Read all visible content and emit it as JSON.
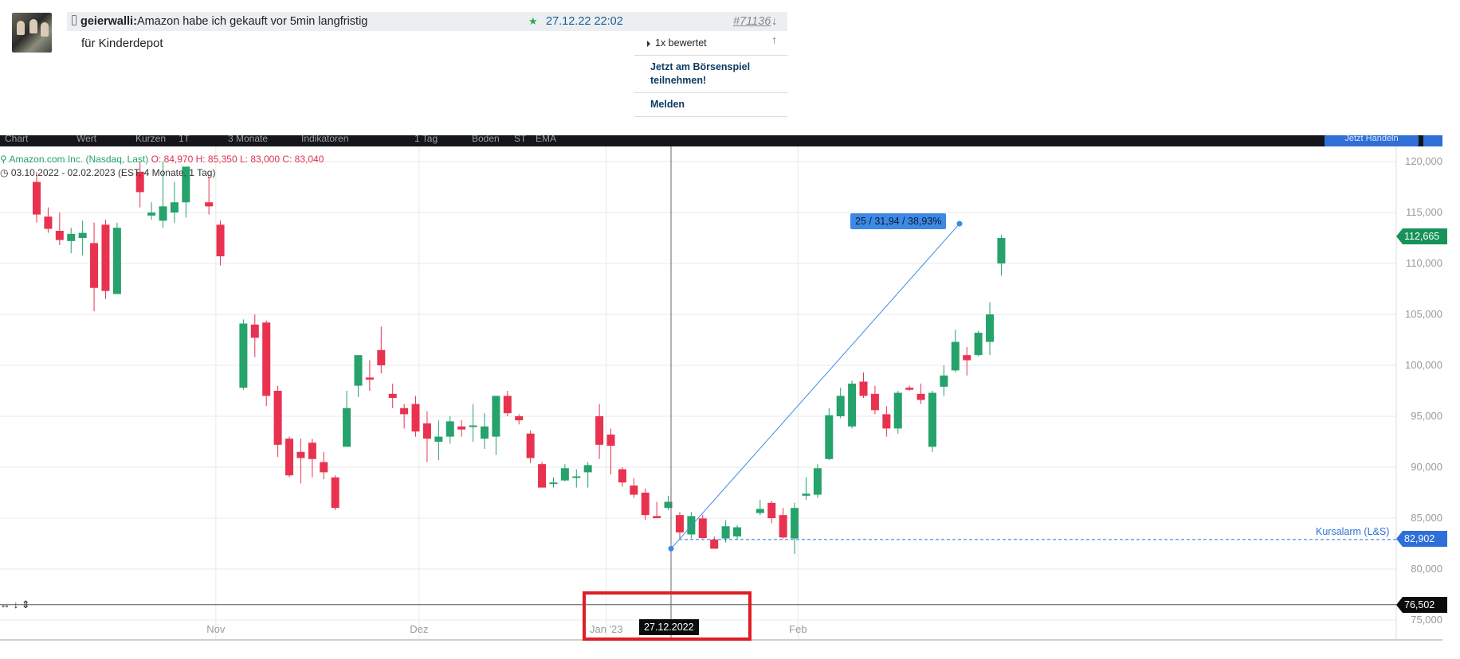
{
  "post": {
    "author": "geierwalli:",
    "title": "Amazon habe ich gekauft vor 5min langfristig",
    "star": "★",
    "date": "27.12.22 22:02",
    "number": "#71136",
    "arrows": "↓ ↑",
    "body": "für Kinderdepot"
  },
  "sidebar": {
    "rated": "1x bewertet",
    "join_line1": "Jetzt am Börsenspiel",
    "join_line2": "teilnehmen!",
    "report": "Melden"
  },
  "toolbar": {
    "items": [
      "Chart",
      "Wert",
      "Kurzen",
      "1T",
      "3 Monate",
      "Indikatoren",
      "1 Tag",
      "Boden",
      "ST",
      "EMA"
    ],
    "order_button": "Jetzt Handeln"
  },
  "legend": {
    "name": "Amazon.com Inc. (Nasdaq, Last)",
    "ohlc": "O: 84,970  H: 85,350  L: 83,000  C: 83,040",
    "range": "03.10.2022 - 02.02.2023",
    "range_info": "(EST, 4 Monate, 1 Tag)"
  },
  "overlays": {
    "crosshair_date": "27.12.2022",
    "last_price": "112,665",
    "alert_price": "82,902",
    "alert_label": "Kursalarm (L&S)",
    "crosshair_price": "76,502",
    "measure": "25 / 31,94 / 38,93%",
    "left_tools": "↔ ↓ ⇕"
  },
  "colors": {
    "up": "#26a26b",
    "down": "#e8324f",
    "alert": "#2e6fd8",
    "grid": "#e9e9e9"
  },
  "chart_data": {
    "type": "candlestick",
    "ylim": [
      75000,
      120000
    ],
    "y_ticks": [
      "120,000",
      "115,000",
      "110,000",
      "105,000",
      "100,000",
      "95,000",
      "90,000",
      "85,000",
      "80,000",
      "75,000"
    ],
    "x_ticks": [
      "Nov",
      "Dez",
      "Jan '23",
      "Feb"
    ],
    "candles": [
      {
        "i": 0,
        "o": 118.0,
        "h": 119.0,
        "l": 114.0,
        "c": 114.8
      },
      {
        "i": 1,
        "o": 114.6,
        "h": 115.5,
        "l": 113.0,
        "c": 113.4
      },
      {
        "i": 2,
        "o": 113.2,
        "h": 115.0,
        "l": 111.8,
        "c": 112.3
      },
      {
        "i": 3,
        "o": 112.2,
        "h": 113.5,
        "l": 111.0,
        "c": 112.9
      },
      {
        "i": 4,
        "o": 112.5,
        "h": 114.2,
        "l": 110.8,
        "c": 113.0
      },
      {
        "i": 5,
        "o": 112.0,
        "h": 114.0,
        "l": 105.3,
        "c": 107.6
      },
      {
        "i": 6,
        "o": 113.8,
        "h": 114.3,
        "l": 106.5,
        "c": 107.3
      },
      {
        "i": 7,
        "o": 107.0,
        "h": 114.0,
        "l": 107.0,
        "c": 113.5
      },
      {
        "i": 9,
        "o": 119.0,
        "h": 120.0,
        "l": 115.5,
        "c": 117.0
      },
      {
        "i": 10,
        "o": 114.7,
        "h": 116.0,
        "l": 114.3,
        "c": 115.0
      },
      {
        "i": 11,
        "o": 114.2,
        "h": 120.0,
        "l": 113.5,
        "c": 115.6
      },
      {
        "i": 12,
        "o": 115.0,
        "h": 118.0,
        "l": 114.0,
        "c": 116.0
      },
      {
        "i": 13,
        "o": 116.0,
        "h": 119.0,
        "l": 114.5,
        "c": 119.5
      },
      {
        "i": 15,
        "o": 116.0,
        "h": 118.5,
        "l": 114.8,
        "c": 115.6
      },
      {
        "i": 16,
        "o": 113.8,
        "h": 114.2,
        "l": 109.8,
        "c": 110.7
      },
      {
        "i": 18,
        "o": 97.8,
        "h": 104.5,
        "l": 97.6,
        "c": 104.1
      },
      {
        "i": 19,
        "o": 104.0,
        "h": 105.0,
        "l": 100.8,
        "c": 102.7
      },
      {
        "i": 20,
        "o": 104.2,
        "h": 104.4,
        "l": 96.0,
        "c": 97.0
      },
      {
        "i": 21,
        "o": 97.5,
        "h": 98.0,
        "l": 91.0,
        "c": 92.2
      },
      {
        "i": 22,
        "o": 92.8,
        "h": 93.0,
        "l": 89.0,
        "c": 89.2
      },
      {
        "i": 23,
        "o": 91.5,
        "h": 92.8,
        "l": 88.4,
        "c": 90.9
      },
      {
        "i": 24,
        "o": 92.4,
        "h": 92.8,
        "l": 89.0,
        "c": 90.8
      },
      {
        "i": 25,
        "o": 90.5,
        "h": 91.5,
        "l": 88.8,
        "c": 89.5
      },
      {
        "i": 26,
        "o": 89.0,
        "h": 89.2,
        "l": 85.8,
        "c": 86.0
      },
      {
        "i": 27,
        "o": 92.0,
        "h": 97.5,
        "l": 92.0,
        "c": 95.8
      },
      {
        "i": 28,
        "o": 98.0,
        "h": 101.0,
        "l": 96.9,
        "c": 101.0
      },
      {
        "i": 29,
        "o": 98.8,
        "h": 100.5,
        "l": 97.5,
        "c": 98.6
      },
      {
        "i": 30,
        "o": 101.5,
        "h": 103.8,
        "l": 99.2,
        "c": 100.0
      },
      {
        "i": 31,
        "o": 97.2,
        "h": 98.2,
        "l": 95.8,
        "c": 96.8
      },
      {
        "i": 32,
        "o": 95.8,
        "h": 96.2,
        "l": 93.8,
        "c": 95.2
      },
      {
        "i": 33,
        "o": 96.2,
        "h": 97.0,
        "l": 93.0,
        "c": 93.5
      },
      {
        "i": 34,
        "o": 94.3,
        "h": 95.5,
        "l": 90.5,
        "c": 92.8
      },
      {
        "i": 35,
        "o": 92.5,
        "h": 94.6,
        "l": 90.7,
        "c": 93.0
      },
      {
        "i": 36,
        "o": 93.0,
        "h": 95.0,
        "l": 92.3,
        "c": 94.5
      },
      {
        "i": 37,
        "o": 94.0,
        "h": 94.6,
        "l": 93.0,
        "c": 93.7
      },
      {
        "i": 38,
        "o": 94.0,
        "h": 96.2,
        "l": 92.5,
        "c": 94.1
      },
      {
        "i": 39,
        "o": 92.8,
        "h": 95.3,
        "l": 91.8,
        "c": 94.0
      },
      {
        "i": 40,
        "o": 93.0,
        "h": 97.0,
        "l": 91.2,
        "c": 97.0
      },
      {
        "i": 41,
        "o": 97.0,
        "h": 97.5,
        "l": 95.0,
        "c": 95.3
      },
      {
        "i": 42,
        "o": 95.0,
        "h": 95.2,
        "l": 94.2,
        "c": 94.6
      },
      {
        "i": 43,
        "o": 93.3,
        "h": 93.6,
        "l": 90.4,
        "c": 90.9
      },
      {
        "i": 44,
        "o": 90.3,
        "h": 90.5,
        "l": 88.2,
        "c": 88.0
      },
      {
        "i": 45,
        "o": 88.4,
        "h": 89.0,
        "l": 88.0,
        "c": 88.5
      },
      {
        "i": 46,
        "o": 88.7,
        "h": 90.3,
        "l": 88.6,
        "c": 89.9
      },
      {
        "i": 47,
        "o": 89.0,
        "h": 89.8,
        "l": 88.0,
        "c": 89.1
      },
      {
        "i": 48,
        "o": 89.5,
        "h": 90.5,
        "l": 88.0,
        "c": 90.2
      },
      {
        "i": 49,
        "o": 95.0,
        "h": 96.2,
        "l": 90.8,
        "c": 92.2
      },
      {
        "i": 50,
        "o": 93.2,
        "h": 93.8,
        "l": 89.3,
        "c": 92.1
      },
      {
        "i": 51,
        "o": 89.8,
        "h": 90.0,
        "l": 88.1,
        "c": 88.5
      },
      {
        "i": 52,
        "o": 88.2,
        "h": 88.9,
        "l": 87.0,
        "c": 87.3
      },
      {
        "i": 53,
        "o": 87.5,
        "h": 87.9,
        "l": 84.8,
        "c": 85.3
      },
      {
        "i": 54,
        "o": 85.2,
        "h": 86.6,
        "l": 85.0,
        "c": 85.0
      },
      {
        "i": 55,
        "o": 86.0,
        "h": 87.2,
        "l": 85.8,
        "c": 86.6
      },
      {
        "i": 56,
        "o": 85.3,
        "h": 85.6,
        "l": 83.0,
        "c": 83.6
      },
      {
        "i": 57,
        "o": 83.4,
        "h": 85.6,
        "l": 83.0,
        "c": 85.2
      },
      {
        "i": 58,
        "o": 84.97,
        "h": 85.35,
        "l": 83.0,
        "c": 83.04
      },
      {
        "i": 59,
        "o": 82.9,
        "h": 83.2,
        "l": 82.0,
        "c": 82.0
      },
      {
        "i": 60,
        "o": 83.0,
        "h": 84.8,
        "l": 82.6,
        "c": 84.2
      },
      {
        "i": 61,
        "o": 83.2,
        "h": 84.3,
        "l": 82.9,
        "c": 84.1
      },
      {
        "i": 63,
        "o": 85.5,
        "h": 86.8,
        "l": 85.3,
        "c": 85.9
      },
      {
        "i": 64,
        "o": 86.5,
        "h": 86.7,
        "l": 84.5,
        "c": 85.0
      },
      {
        "i": 65,
        "o": 85.3,
        "h": 86.0,
        "l": 83.0,
        "c": 83.1
      },
      {
        "i": 66,
        "o": 83.0,
        "h": 86.5,
        "l": 81.5,
        "c": 86.0
      },
      {
        "i": 67,
        "o": 87.2,
        "h": 89.0,
        "l": 86.8,
        "c": 87.4
      },
      {
        "i": 68,
        "o": 87.3,
        "h": 90.3,
        "l": 87.0,
        "c": 89.9
      },
      {
        "i": 69,
        "o": 90.8,
        "h": 95.8,
        "l": 90.7,
        "c": 95.1
      },
      {
        "i": 70,
        "o": 95.0,
        "h": 97.8,
        "l": 94.8,
        "c": 97.0
      },
      {
        "i": 71,
        "o": 94.0,
        "h": 98.5,
        "l": 93.8,
        "c": 98.2
      },
      {
        "i": 72,
        "o": 98.4,
        "h": 99.3,
        "l": 96.8,
        "c": 97.0
      },
      {
        "i": 73,
        "o": 97.2,
        "h": 98.0,
        "l": 95.2,
        "c": 95.6
      },
      {
        "i": 74,
        "o": 95.2,
        "h": 96.0,
        "l": 93.0,
        "c": 93.8
      },
      {
        "i": 75,
        "o": 93.8,
        "h": 97.5,
        "l": 93.3,
        "c": 97.3
      },
      {
        "i": 76,
        "o": 97.8,
        "h": 98.0,
        "l": 97.5,
        "c": 97.6
      },
      {
        "i": 77,
        "o": 97.2,
        "h": 98.2,
        "l": 96.2,
        "c": 96.6
      },
      {
        "i": 78,
        "o": 92.0,
        "h": 97.5,
        "l": 91.5,
        "c": 97.3
      },
      {
        "i": 79,
        "o": 97.9,
        "h": 100.0,
        "l": 97.0,
        "c": 99.0
      },
      {
        "i": 80,
        "o": 99.5,
        "h": 103.5,
        "l": 99.3,
        "c": 102.3
      },
      {
        "i": 81,
        "o": 101.0,
        "h": 101.8,
        "l": 99.0,
        "c": 100.5
      },
      {
        "i": 82,
        "o": 101.0,
        "h": 103.4,
        "l": 100.9,
        "c": 103.2
      },
      {
        "i": 83,
        "o": 102.3,
        "h": 106.2,
        "l": 101.0,
        "c": 105.0
      },
      {
        "i": 84,
        "o": 110.0,
        "h": 112.8,
        "l": 108.8,
        "c": 112.5
      }
    ]
  }
}
